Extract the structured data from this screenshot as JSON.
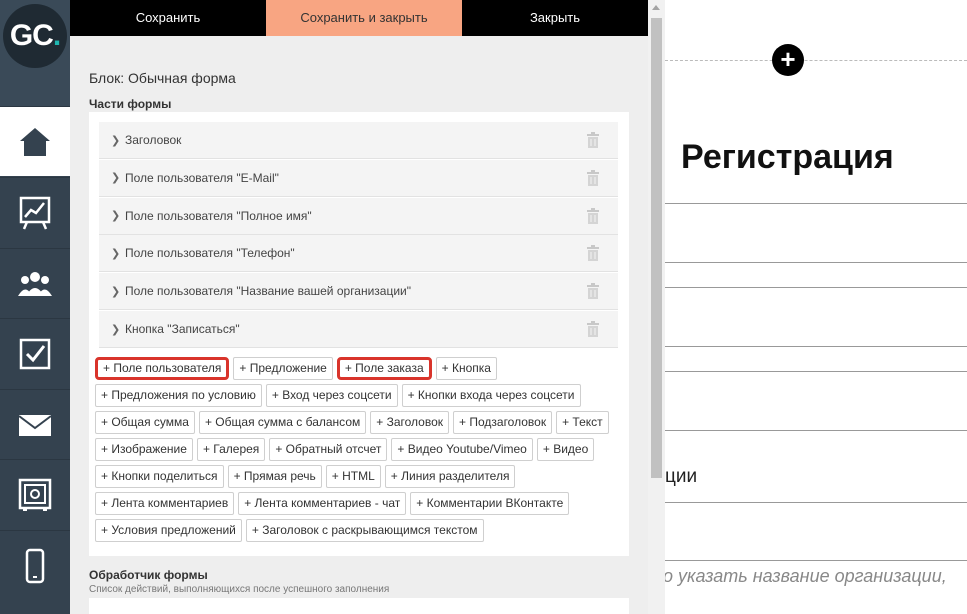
{
  "logo": {
    "text": "GC",
    "dot": "."
  },
  "sidebar": {
    "items": [
      {
        "name": "home-icon",
        "active": true
      },
      {
        "name": "chart-icon"
      },
      {
        "name": "users-icon"
      },
      {
        "name": "checkbox-icon"
      },
      {
        "name": "mail-icon"
      },
      {
        "name": "safe-icon"
      },
      {
        "name": "mobile-icon"
      }
    ]
  },
  "toolbar": {
    "save_label": "Сохранить",
    "save_close_label": "Сохранить и закрыть",
    "close_label": "Закрыть"
  },
  "editor": {
    "block_title": "Блок: Обычная форма",
    "parts_title": "Части формы",
    "parts": [
      "Заголовок",
      "Поле пользователя \"E-Mail\"",
      "Поле пользователя \"Полное имя\"",
      "Поле пользователя \"Телефон\"",
      "Поле пользователя \"Название вашей организации\"",
      "Кнопка \"Записаться\""
    ],
    "add_buttons": [
      [
        "+ Поле пользователя",
        "+ Предложение",
        "+ Поле заказа",
        "+ Кнопка"
      ],
      [
        "+ Предложения по условию",
        "+ Вход через соцсети",
        "+ Кнопки входа через соцсети"
      ],
      [
        "+ Общая сумма",
        "+ Общая сумма с балансом",
        "+ Заголовок",
        "+ Подзаголовок",
        "+ Текст"
      ],
      [
        "+ Изображение",
        "+ Галерея",
        "+ Обратный отсчет",
        "+ Видео Youtube/Vimeo",
        "+ Видео"
      ],
      [
        "+ Кнопки поделиться",
        "+ Прямая речь",
        "+ HTML",
        "+ Линия разделителя"
      ],
      [
        "+ Лента комментариев",
        "+ Лента комментариев - чат",
        "+ Комментарии ВКонтакте"
      ],
      [
        "+ Условия предложений",
        "+ Заголовок с раскрывающимся текстом"
      ]
    ],
    "highlighted": [
      "+ Поле пользователя",
      "+ Поле заказа"
    ],
    "handler_title": "Обработчик формы",
    "handler_desc": "Список действий, выполняющихся после успешного заполнения"
  },
  "preview": {
    "title": "Регистрация",
    "fragment_1": "ции",
    "fragment_2": "о указать название организации,"
  },
  "colors": {
    "sidebar_bg": "#34424f",
    "save_close_bg": "#f8a582",
    "highlight": "#d9342b",
    "logo_accent": "#1fb6b0"
  }
}
